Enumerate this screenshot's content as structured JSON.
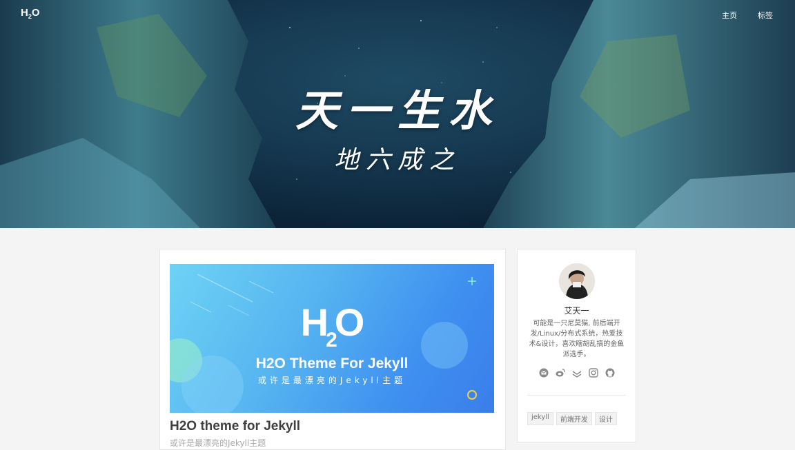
{
  "header": {
    "logo_main": "H",
    "logo_sub": "2",
    "logo_end": "O",
    "nav": [
      {
        "label": "主页"
      },
      {
        "label": "标签"
      }
    ],
    "hero_title": "天一生水",
    "hero_subtitle": "地六成之"
  },
  "post": {
    "cover": {
      "logo_h": "H",
      "logo_2": "2",
      "logo_o": "O",
      "title": "H2O Theme For Jekyll",
      "subtitle": "或许是最漂亮的Jekyll主题"
    },
    "title": "H2O theme for Jekyll",
    "excerpt": "或许是最漂亮的Jekyll主题"
  },
  "sidebar": {
    "author_name": "艾天一",
    "bio": "可能是一只尼莫猫, 前后端开发/Linux/分布式系统，热爱技术&设计，喜欢瞎胡乱搞的金鱼派选手。",
    "socials": [
      "mail-icon",
      "weibo-icon",
      "zhihu-icon",
      "instagram-icon",
      "github-icon"
    ],
    "tags": [
      {
        "label": "jekyll"
      },
      {
        "label": "前端开发"
      },
      {
        "label": "设计"
      }
    ]
  },
  "colors": {
    "accent_blue": "#3e8ff0",
    "hero_dark": "#0c2337",
    "page_bg": "#f4f4f4"
  }
}
